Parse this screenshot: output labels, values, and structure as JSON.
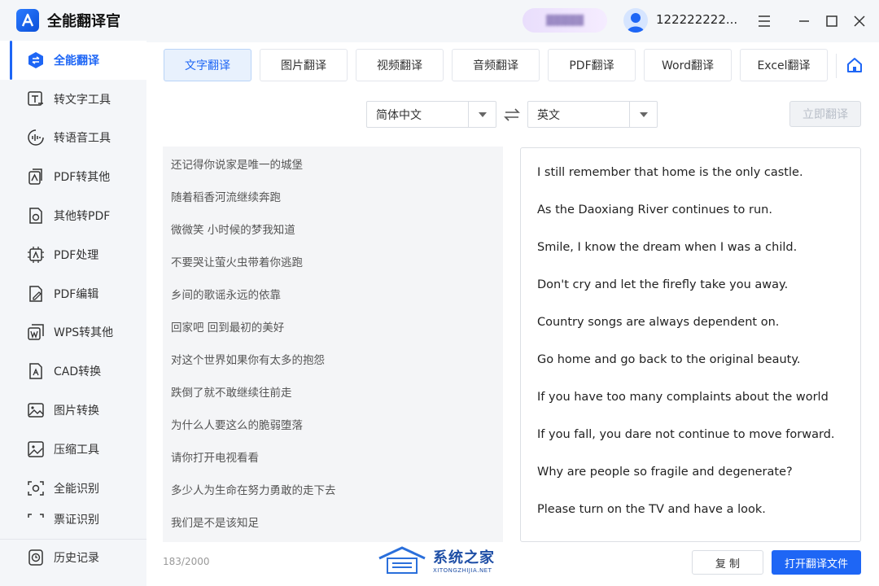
{
  "app": {
    "title": "全能翻译官"
  },
  "titlebar": {
    "vip_label": "▓▓▓▓▓",
    "username": "122222222..."
  },
  "sidebar": {
    "items": [
      {
        "label": "全能翻译",
        "icon": "translate-icon"
      },
      {
        "label": "转文字工具",
        "icon": "text-tool-icon"
      },
      {
        "label": "转语音工具",
        "icon": "voice-tool-icon"
      },
      {
        "label": "PDF转其他",
        "icon": "pdf-convert-icon"
      },
      {
        "label": "其他转PDF",
        "icon": "to-pdf-icon"
      },
      {
        "label": "PDF处理",
        "icon": "pdf-process-icon"
      },
      {
        "label": "PDF编辑",
        "icon": "pdf-edit-icon"
      },
      {
        "label": "WPS转其他",
        "icon": "wps-convert-icon"
      },
      {
        "label": "CAD转换",
        "icon": "cad-convert-icon"
      },
      {
        "label": "图片转换",
        "icon": "image-convert-icon"
      },
      {
        "label": "压缩工具",
        "icon": "compress-icon"
      },
      {
        "label": "全能识别",
        "icon": "recognize-icon"
      },
      {
        "label": "票证识别",
        "icon": "ticket-icon"
      }
    ],
    "history": "历史记录"
  },
  "tabs": [
    "文字翻译",
    "图片翻译",
    "视频翻译",
    "音频翻译",
    "PDF翻译",
    "Word翻译",
    "Excel翻译"
  ],
  "languages": {
    "source": "简体中文",
    "target": "英文"
  },
  "actions": {
    "translate": "立即翻译",
    "copy": "复 制",
    "open_file": "打开翻译文件"
  },
  "source_lines": [
    "还记得你说家是唯一的城堡",
    "随着稻香河流继续奔跑",
    "微微笑 小时候的梦我知道",
    "不要哭让萤火虫带着你逃跑",
    "乡间的歌谣永远的依靠",
    "回家吧 回到最初的美好",
    "对这个世界如果你有太多的抱怨",
    "跌倒了就不敢继续往前走",
    "为什么人要这么的脆弱堕落",
    "请你打开电视看看",
    "多少人为生命在努力勇敢的走下去",
    "我们是不是该知足"
  ],
  "target_lines": [
    "I still remember that home is the only castle.",
    "As the Daoxiang River continues to run.",
    "Smile, I know the dream when I was a child.",
    "Don't cry and let the firefly take you away.",
    "Country songs are always dependent on.",
    "Go home and go back to the original beauty.",
    "If you have too many complaints about the world",
    "If you fall, you dare not continue to move forward.",
    "Why are people so fragile and degenerate?",
    "Please turn on the TV and have a look."
  ],
  "char_count": "183/2000",
  "watermark": {
    "cn": "系统之家",
    "en": "XITONGZHIJIA.NET"
  },
  "colors": {
    "accent": "#1e66f5",
    "sidebar_bg": "#f4f6f9",
    "tab_active_bg": "#e8f1fd"
  }
}
